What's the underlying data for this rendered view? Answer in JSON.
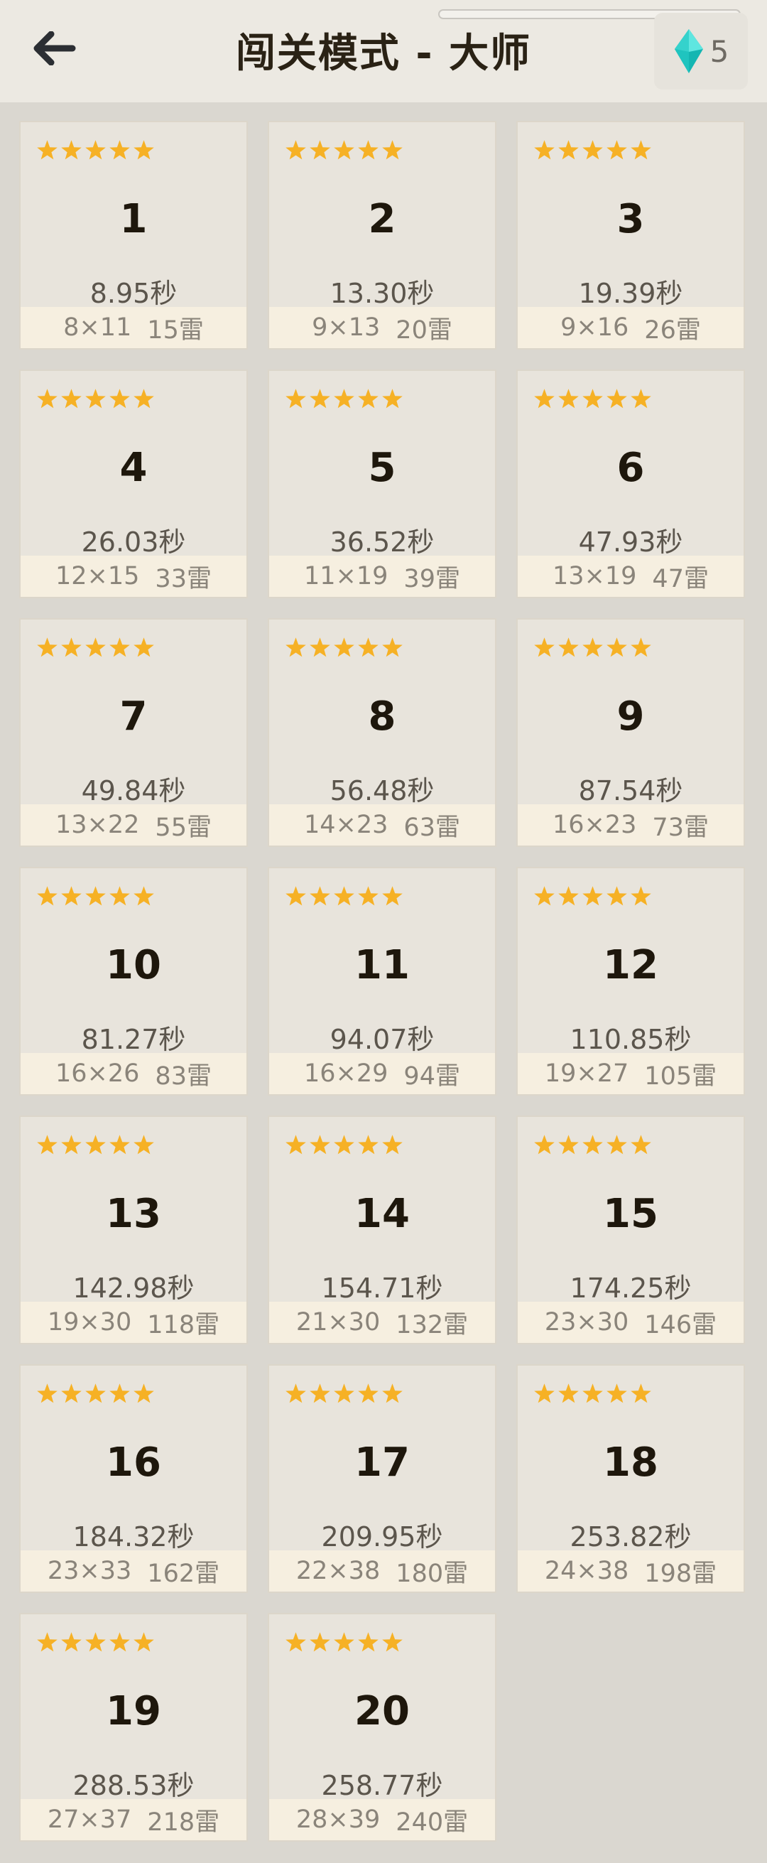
{
  "header": {
    "title": "闯关模式 - 大师",
    "back_icon": "arrow-left-icon",
    "gem_icon": "diamond-gem-icon",
    "gem_count": "5"
  },
  "colors": {
    "star": "#f6b125",
    "gem_light": "#5fe6e0",
    "gem_dark": "#14b6b2"
  },
  "levels": [
    {
      "number": "1",
      "stars": 5,
      "time": "8.95秒",
      "size": "8×11",
      "mines": "15雷"
    },
    {
      "number": "2",
      "stars": 5,
      "time": "13.30秒",
      "size": "9×13",
      "mines": "20雷"
    },
    {
      "number": "3",
      "stars": 5,
      "time": "19.39秒",
      "size": "9×16",
      "mines": "26雷"
    },
    {
      "number": "4",
      "stars": 5,
      "time": "26.03秒",
      "size": "12×15",
      "mines": "33雷"
    },
    {
      "number": "5",
      "stars": 5,
      "time": "36.52秒",
      "size": "11×19",
      "mines": "39雷"
    },
    {
      "number": "6",
      "stars": 5,
      "time": "47.93秒",
      "size": "13×19",
      "mines": "47雷"
    },
    {
      "number": "7",
      "stars": 5,
      "time": "49.84秒",
      "size": "13×22",
      "mines": "55雷"
    },
    {
      "number": "8",
      "stars": 5,
      "time": "56.48秒",
      "size": "14×23",
      "mines": "63雷"
    },
    {
      "number": "9",
      "stars": 5,
      "time": "87.54秒",
      "size": "16×23",
      "mines": "73雷"
    },
    {
      "number": "10",
      "stars": 5,
      "time": "81.27秒",
      "size": "16×26",
      "mines": "83雷"
    },
    {
      "number": "11",
      "stars": 5,
      "time": "94.07秒",
      "size": "16×29",
      "mines": "94雷"
    },
    {
      "number": "12",
      "stars": 5,
      "time": "110.85秒",
      "size": "19×27",
      "mines": "105雷"
    },
    {
      "number": "13",
      "stars": 5,
      "time": "142.98秒",
      "size": "19×30",
      "mines": "118雷"
    },
    {
      "number": "14",
      "stars": 5,
      "time": "154.71秒",
      "size": "21×30",
      "mines": "132雷"
    },
    {
      "number": "15",
      "stars": 5,
      "time": "174.25秒",
      "size": "23×30",
      "mines": "146雷"
    },
    {
      "number": "16",
      "stars": 5,
      "time": "184.32秒",
      "size": "23×33",
      "mines": "162雷"
    },
    {
      "number": "17",
      "stars": 5,
      "time": "209.95秒",
      "size": "22×38",
      "mines": "180雷"
    },
    {
      "number": "18",
      "stars": 5,
      "time": "253.82秒",
      "size": "24×38",
      "mines": "198雷"
    },
    {
      "number": "19",
      "stars": 5,
      "time": "288.53秒",
      "size": "27×37",
      "mines": "218雷"
    },
    {
      "number": "20",
      "stars": 5,
      "time": "258.77秒",
      "size": "28×39",
      "mines": "240雷"
    }
  ]
}
